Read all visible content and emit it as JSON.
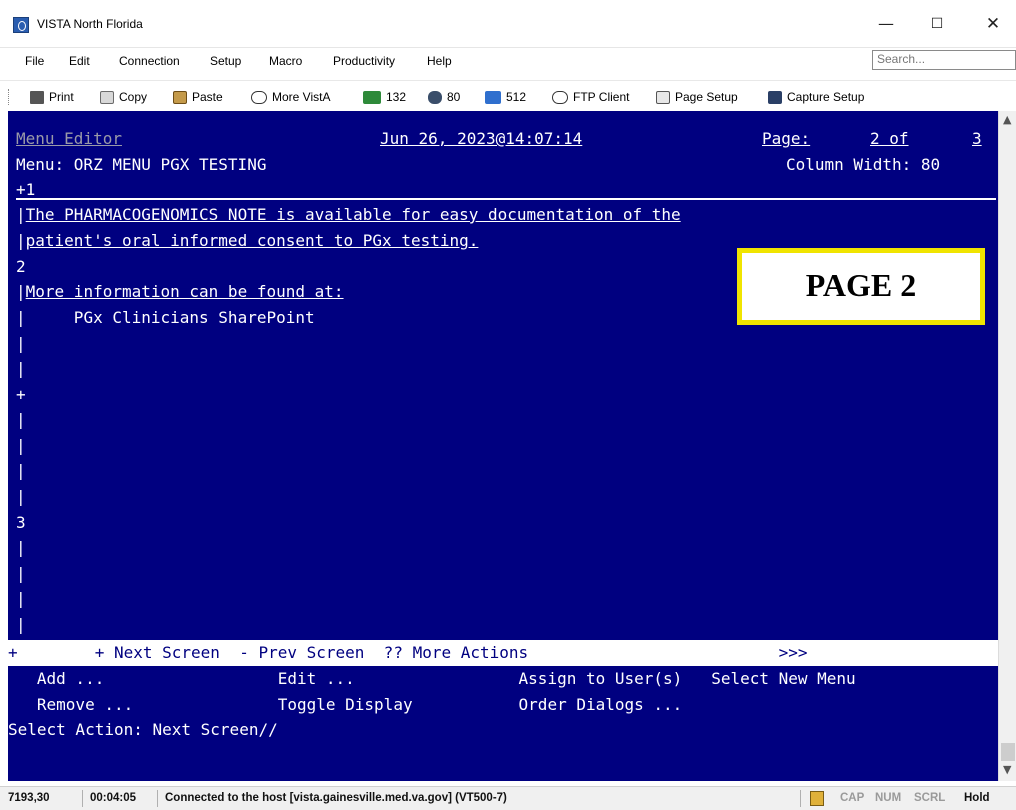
{
  "window": {
    "title": "VISTA North Florida",
    "minimize": "—",
    "maximize": "☐",
    "close": "✕"
  },
  "menu": {
    "items": [
      "File",
      "Edit",
      "Connection",
      "Setup",
      "Macro",
      "Productivity",
      "Help"
    ],
    "search_placeholder": "Search..."
  },
  "toolbar": {
    "items": [
      {
        "label": "Print",
        "icon": "printer-icon"
      },
      {
        "label": "Copy",
        "icon": "copy-icon"
      },
      {
        "label": "Paste",
        "icon": "paste-icon"
      },
      {
        "label": "More VistA",
        "icon": "more-vista-icon"
      },
      {
        "label": "132",
        "icon": "columns-132-icon"
      },
      {
        "label": "80",
        "icon": "columns-80-icon"
      },
      {
        "label": "512",
        "icon": "buffer-512-icon"
      },
      {
        "label": "FTP Client",
        "icon": "ftp-icon"
      },
      {
        "label": "Page Setup",
        "icon": "page-setup-icon"
      },
      {
        "label": "Capture Setup",
        "icon": "capture-icon"
      }
    ]
  },
  "terminal": {
    "header_title": "Menu Editor",
    "header_date": "Jun 26, 2023@14:07:14",
    "header_page_label": "Page:",
    "header_page_value": "2 of",
    "header_page_total": "3",
    "menu_line": "Menu: ORZ MENU PGX TESTING",
    "column_width": "Column Width: 80",
    "plus_one": "+1",
    "line1": "The PHARMACOGENOMICS NOTE is available for easy documentation of the",
    "line2": "patient's oral informed consent to PGx testing.",
    "num2": "2",
    "line3": "More information can be found at:",
    "line4": "     PGx Clinicians SharePoint",
    "plus": "+",
    "num3": "3",
    "cmd_bar": "+        + Next Screen  - Prev Screen  ?? More Actions                          >>>",
    "actions_row1": "   Add ...                  Edit ...                 Assign to User(s)   Select New Menu",
    "actions_row2": "   Remove ...               Toggle Display           Order Dialogs ...",
    "prompt": "Select Action: Next Screen//",
    "overlay_label": "PAGE 2"
  },
  "status": {
    "cursor": "7193,30",
    "time": "00:04:05",
    "connection": "Connected to the host [vista.gainesville.med.va.gov] (VT500-7)",
    "cap": "CAP",
    "num": "NUM",
    "scrl": "SCRL",
    "hold": "Hold"
  }
}
